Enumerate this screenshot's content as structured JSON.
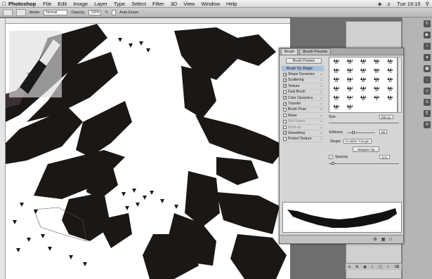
{
  "menubar": {
    "app_name": "Photoshop",
    "items": [
      "File",
      "Edit",
      "Image",
      "Layer",
      "Type",
      "Select",
      "Filter",
      "3D",
      "View",
      "Window",
      "Help"
    ],
    "clock": "Tue 19:15"
  },
  "options": {
    "mode_label": "Mode:",
    "mode_value": "Normal",
    "opacity_label": "Opacity:",
    "opacity_value": "100%",
    "auto_erase": "Auto Erase"
  },
  "brush_panel": {
    "tabs": [
      "Brush",
      "Brush Presets"
    ],
    "presets_button": "Brush Presets",
    "tip_shape_header": "Brush Tip Shape",
    "options": [
      {
        "label": "Shape Dynamics",
        "checked": true,
        "dim": false
      },
      {
        "label": "Scattering",
        "checked": true,
        "dim": false
      },
      {
        "label": "Texture",
        "checked": true,
        "dim": false
      },
      {
        "label": "Dual Brush",
        "checked": false,
        "dim": false
      },
      {
        "label": "Color Dynamics",
        "checked": true,
        "dim": false
      },
      {
        "label": "Transfer",
        "checked": true,
        "dim": false
      },
      {
        "label": "Brush Pose",
        "checked": false,
        "dim": false
      },
      {
        "label": "Noise",
        "checked": false,
        "dim": false
      },
      {
        "label": "Wet Edges",
        "checked": false,
        "dim": true
      },
      {
        "label": "Build-up",
        "checked": false,
        "dim": true
      },
      {
        "label": "Smoothing",
        "checked": true,
        "dim": false
      },
      {
        "label": "Protect Texture",
        "checked": false,
        "dim": false
      }
    ],
    "grid_sizes": [
      "30",
      "30",
      "30",
      "25",
      "25",
      "50",
      "25",
      "25",
      "50",
      "71",
      "25",
      "50",
      "36",
      "30",
      "30",
      "30",
      "30",
      "30",
      "30",
      "25",
      "20",
      "9",
      "30",
      "9",
      "25",
      "30",
      "30"
    ],
    "size_label": "Size",
    "size_value": "800 px",
    "softness_label": "Softness:",
    "softness_value": "86",
    "softness_pct": 20,
    "shape_label": "Shape:",
    "shape_value": "Erodible Triangle",
    "sharpen_button": "Sharpen Tip",
    "spacing_label": "Spacing",
    "spacing_value": "11%",
    "spacing_checked": true
  },
  "side_panel": {
    "labels": [
      "100%",
      "100%",
      "100%",
      "100%"
    ]
  },
  "colors": {
    "ink": "#1a1715",
    "selection": "#a8bfdc"
  }
}
